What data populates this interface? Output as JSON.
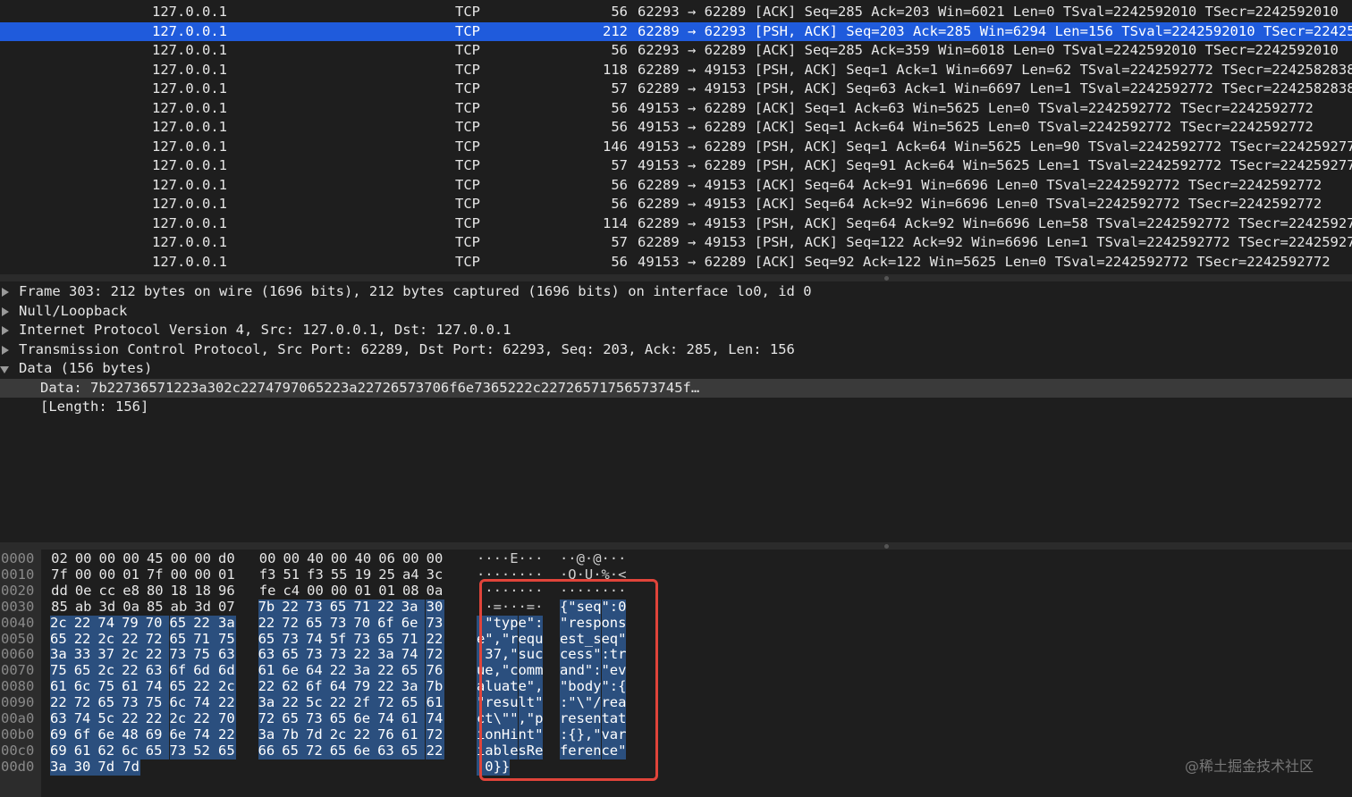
{
  "packet_list": {
    "rows": [
      {
        "source": "127.0.0.1",
        "protocol": "TCP",
        "length": "56",
        "info": "62293 → 62289 [ACK] Seq=285 Ack=203 Win=6021 Len=0 TSval=2242592010 TSecr=2242592010",
        "selected": false
      },
      {
        "source": "127.0.0.1",
        "protocol": "TCP",
        "length": "212",
        "info": "62289 → 62293 [PSH, ACK] Seq=203 Ack=285 Win=6294 Len=156 TSval=2242592010 TSecr=22425",
        "selected": true
      },
      {
        "source": "127.0.0.1",
        "protocol": "TCP",
        "length": "56",
        "info": "62293 → 62289 [ACK] Seq=285 Ack=359 Win=6018 Len=0 TSval=2242592010 TSecr=2242592010",
        "selected": false
      },
      {
        "source": "127.0.0.1",
        "protocol": "TCP",
        "length": "118",
        "info": "62289 → 49153 [PSH, ACK] Seq=1 Ack=1 Win=6697 Len=62 TSval=2242592772 TSecr=2242582838",
        "selected": false
      },
      {
        "source": "127.0.0.1",
        "protocol": "TCP",
        "length": "57",
        "info": "62289 → 49153 [PSH, ACK] Seq=63 Ack=1 Win=6697 Len=1 TSval=2242592772 TSecr=2242582838",
        "selected": false
      },
      {
        "source": "127.0.0.1",
        "protocol": "TCP",
        "length": "56",
        "info": "49153 → 62289 [ACK] Seq=1 Ack=63 Win=5625 Len=0 TSval=2242592772 TSecr=2242592772",
        "selected": false
      },
      {
        "source": "127.0.0.1",
        "protocol": "TCP",
        "length": "56",
        "info": "49153 → 62289 [ACK] Seq=1 Ack=64 Win=5625 Len=0 TSval=2242592772 TSecr=2242592772",
        "selected": false
      },
      {
        "source": "127.0.0.1",
        "protocol": "TCP",
        "length": "146",
        "info": "49153 → 62289 [PSH, ACK] Seq=1 Ack=64 Win=5625 Len=90 TSval=2242592772 TSecr=224259277",
        "selected": false
      },
      {
        "source": "127.0.0.1",
        "protocol": "TCP",
        "length": "57",
        "info": "49153 → 62289 [PSH, ACK] Seq=91 Ack=64 Win=5625 Len=1 TSval=2242592772 TSecr=224259277",
        "selected": false
      },
      {
        "source": "127.0.0.1",
        "protocol": "TCP",
        "length": "56",
        "info": "62289 → 49153 [ACK] Seq=64 Ack=91 Win=6696 Len=0 TSval=2242592772 TSecr=2242592772",
        "selected": false
      },
      {
        "source": "127.0.0.1",
        "protocol": "TCP",
        "length": "56",
        "info": "62289 → 49153 [ACK] Seq=64 Ack=92 Win=6696 Len=0 TSval=2242592772 TSecr=2242592772",
        "selected": false
      },
      {
        "source": "127.0.0.1",
        "protocol": "TCP",
        "length": "114",
        "info": "62289 → 49153 [PSH, ACK] Seq=64 Ack=92 Win=6696 Len=58 TSval=2242592772 TSecr=22425927",
        "selected": false
      },
      {
        "source": "127.0.0.1",
        "protocol": "TCP",
        "length": "57",
        "info": "62289 → 49153 [PSH, ACK] Seq=122 Ack=92 Win=6696 Len=1 TSval=2242592772 TSecr=22425927",
        "selected": false
      },
      {
        "source": "127.0.0.1",
        "protocol": "TCP",
        "length": "56",
        "info": "49153 → 62289 [ACK] Seq=92 Ack=122 Win=5625 Len=0 TSval=2242592772 TSecr=2242592772",
        "selected": false
      }
    ]
  },
  "details": {
    "rows": [
      {
        "text": "Frame 303: 212 bytes on wire (1696 bits), 212 bytes captured (1696 bits) on interface lo0, id 0",
        "expander": "right",
        "indent": 0
      },
      {
        "text": "Null/Loopback",
        "expander": "right",
        "indent": 0
      },
      {
        "text": "Internet Protocol Version 4, Src: 127.0.0.1, Dst: 127.0.0.1",
        "expander": "right",
        "indent": 0
      },
      {
        "text": "Transmission Control Protocol, Src Port: 62289, Dst Port: 62293, Seq: 203, Ack: 285, Len: 156",
        "expander": "right",
        "indent": 0
      },
      {
        "text": "Data (156 bytes)",
        "expander": "down",
        "indent": 0
      },
      {
        "text": "Data: 7b22736571223a302c2274797065223a22726573706f6e7365222c22726571756573745f…",
        "expander": "none",
        "indent": 1,
        "highlight": true
      },
      {
        "text": "[Length: 156]",
        "expander": "none",
        "indent": 1
      }
    ]
  },
  "hex": {
    "rows": [
      {
        "offset": "0000",
        "bytes": [
          "02",
          "00",
          "00",
          "00",
          "45",
          "00",
          "00",
          "d0",
          "00",
          "00",
          "40",
          "00",
          "40",
          "06",
          "00",
          "00"
        ],
        "ascii": "····E···  ··@·@···",
        "sel_from": 16
      },
      {
        "offset": "0010",
        "bytes": [
          "7f",
          "00",
          "00",
          "01",
          "7f",
          "00",
          "00",
          "01",
          "f3",
          "51",
          "f3",
          "55",
          "19",
          "25",
          "a4",
          "3c"
        ],
        "ascii": "········  ·Q·U·%·<",
        "sel_from": 16
      },
      {
        "offset": "0020",
        "bytes": [
          "dd",
          "0e",
          "cc",
          "e8",
          "80",
          "18",
          "18",
          "96",
          "fe",
          "c4",
          "00",
          "00",
          "01",
          "01",
          "08",
          "0a"
        ],
        "ascii": "········  ········",
        "sel_from": 16
      },
      {
        "offset": "0030",
        "bytes": [
          "85",
          "ab",
          "3d",
          "0a",
          "85",
          "ab",
          "3d",
          "07",
          "7b",
          "22",
          "73",
          "65",
          "71",
          "22",
          "3a",
          "30"
        ],
        "ascii": "··=···=·  {\"seq\":0",
        "sel_from": 8
      },
      {
        "offset": "0040",
        "bytes": [
          "2c",
          "22",
          "74",
          "79",
          "70",
          "65",
          "22",
          "3a",
          "22",
          "72",
          "65",
          "73",
          "70",
          "6f",
          "6e",
          "73"
        ],
        "ascii": ",\"type\":  \"respons",
        "sel_from": 0
      },
      {
        "offset": "0050",
        "bytes": [
          "65",
          "22",
          "2c",
          "22",
          "72",
          "65",
          "71",
          "75",
          "65",
          "73",
          "74",
          "5f",
          "73",
          "65",
          "71",
          "22"
        ],
        "ascii": "e\",\"requ  est_seq\"",
        "sel_from": 0
      },
      {
        "offset": "0060",
        "bytes": [
          "3a",
          "33",
          "37",
          "2c",
          "22",
          "73",
          "75",
          "63",
          "63",
          "65",
          "73",
          "73",
          "22",
          "3a",
          "74",
          "72"
        ],
        "ascii": ":37,\"suc  cess\":tr",
        "sel_from": 0
      },
      {
        "offset": "0070",
        "bytes": [
          "75",
          "65",
          "2c",
          "22",
          "63",
          "6f",
          "6d",
          "6d",
          "61",
          "6e",
          "64",
          "22",
          "3a",
          "22",
          "65",
          "76"
        ],
        "ascii": "ue,\"comm  and\":\"ev",
        "sel_from": 0
      },
      {
        "offset": "0080",
        "bytes": [
          "61",
          "6c",
          "75",
          "61",
          "74",
          "65",
          "22",
          "2c",
          "22",
          "62",
          "6f",
          "64",
          "79",
          "22",
          "3a",
          "7b"
        ],
        "ascii": "aluate\",  \"body\":{",
        "sel_from": 0
      },
      {
        "offset": "0090",
        "bytes": [
          "22",
          "72",
          "65",
          "73",
          "75",
          "6c",
          "74",
          "22",
          "3a",
          "22",
          "5c",
          "22",
          "2f",
          "72",
          "65",
          "61"
        ],
        "ascii": "\"result\"  :\"\\\"/rea",
        "sel_from": 0
      },
      {
        "offset": "00a0",
        "bytes": [
          "63",
          "74",
          "5c",
          "22",
          "22",
          "2c",
          "22",
          "70",
          "72",
          "65",
          "73",
          "65",
          "6e",
          "74",
          "61",
          "74"
        ],
        "ascii": "ct\\\"\",\"p  resentat",
        "sel_from": 0
      },
      {
        "offset": "00b0",
        "bytes": [
          "69",
          "6f",
          "6e",
          "48",
          "69",
          "6e",
          "74",
          "22",
          "3a",
          "7b",
          "7d",
          "2c",
          "22",
          "76",
          "61",
          "72"
        ],
        "ascii": "ionHint\"  :{},\"var",
        "sel_from": 0
      },
      {
        "offset": "00c0",
        "bytes": [
          "69",
          "61",
          "62",
          "6c",
          "65",
          "73",
          "52",
          "65",
          "66",
          "65",
          "72",
          "65",
          "6e",
          "63",
          "65",
          "22"
        ],
        "ascii": "iablesRe  ference\"",
        "sel_from": 0
      },
      {
        "offset": "00d0",
        "bytes": [
          "3a",
          "30",
          "7d",
          "7d"
        ],
        "ascii": ":0}}",
        "sel_from": 0
      }
    ]
  },
  "watermark": "@稀土掘金技术社区",
  "colors": {
    "selected_row": "#1f5bdc",
    "hex_selection": "#2b4f7e",
    "annotation_box": "#e0443a"
  }
}
